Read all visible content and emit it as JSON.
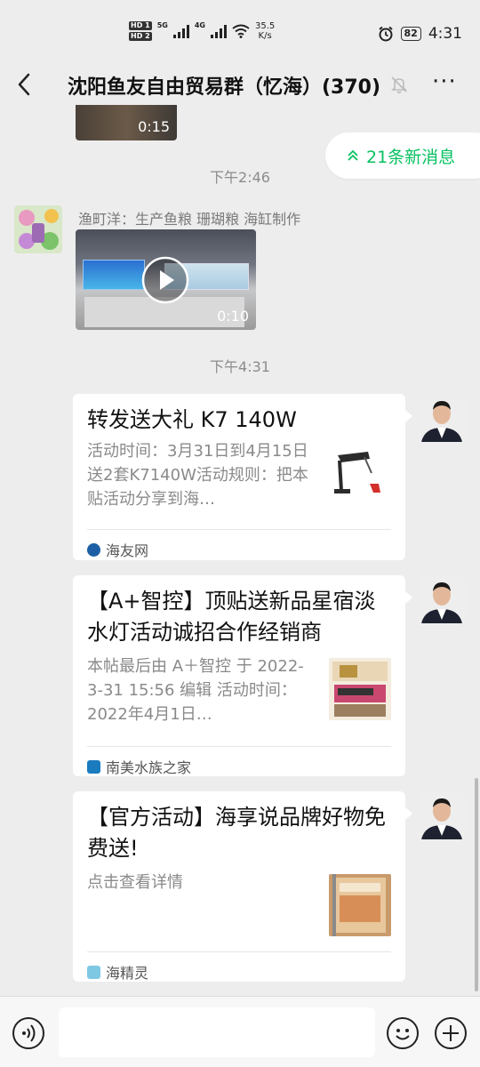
{
  "status_bar": {
    "hd1": "HD 1",
    "hd2": "HD 2",
    "net1": "5G",
    "net2": "4G",
    "speed_value": "35.5",
    "speed_unit": "K/s",
    "battery": "82",
    "time": "4:31",
    "icons": [
      "signal-icon",
      "wifi-icon",
      "alarm-icon",
      "battery-icon"
    ]
  },
  "header": {
    "title": "沈阳鱼友自由贸易群（忆海）(370)",
    "back_icon": "back-arrow-icon",
    "mute_icon": "mute-bell-icon",
    "more_icon": "more-icon"
  },
  "messages": {
    "video1_duration": "0:15",
    "time1": "下午2:46",
    "sender_nick": "渔町洋：生产鱼粮 珊瑚粮 海缸制作",
    "video2_duration": "0:10",
    "time2": "下午4:31",
    "cards": [
      {
        "title": "转发送大礼 K7 140W",
        "desc": "活动时间：3月31日到4月15日送2套K7140W活动规则：把本贴活动分享到海…",
        "source": "海友网"
      },
      {
        "title": "【A+智控】顶贴送新品星宿淡水灯活动诚招合作经销商",
        "desc": " 本帖最后由 A＋智控 于 2022-3-31 15:56 编辑 活动时间：2022年4月1日…",
        "source": "南美水族之家"
      },
      {
        "title": "【官方活动】海享说品牌好物免费送!",
        "desc": "点击查看详情",
        "source": "海精灵"
      }
    ]
  },
  "new_messages": "21条新消息",
  "colors": {
    "accent": "#07c160",
    "background": "#ededed"
  }
}
